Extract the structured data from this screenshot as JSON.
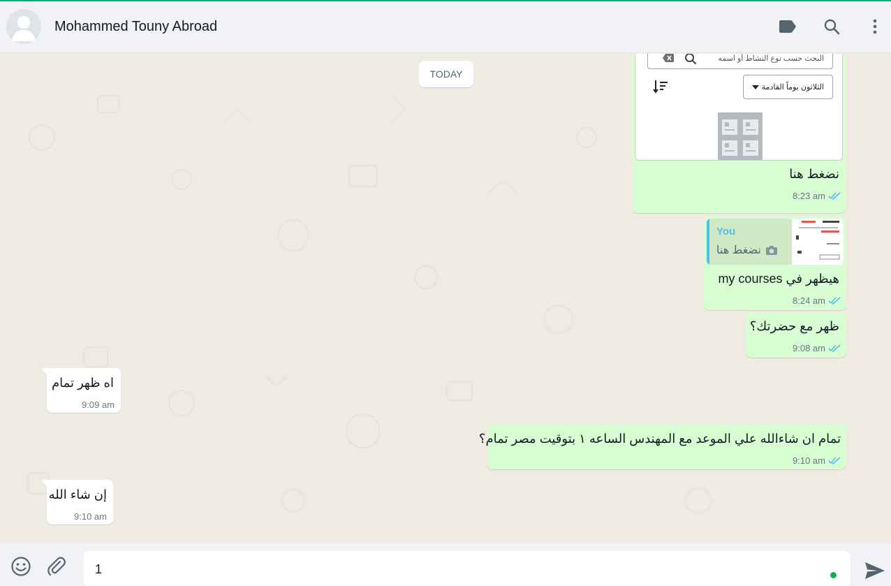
{
  "header": {
    "contact_name": "Mohammed Touny Abroad"
  },
  "chat": {
    "date_separator": "TODAY",
    "messages": [
      {
        "direction": "out",
        "kind": "image",
        "image": {
          "search_placeholder": "البحث حسب نوع النشاط أو اسمه",
          "select_value": "الثلاثون يوماً القادمة"
        },
        "text": "نضغط هنا",
        "time": "8:23 am",
        "status": "read"
      },
      {
        "direction": "out",
        "kind": "reply",
        "quote": {
          "author": "You",
          "text": "نضغط هنا"
        },
        "text": "هيظهر في my courses",
        "time": "8:24 am",
        "status": "read"
      },
      {
        "direction": "out",
        "text": "ظهر مع حضرتك؟",
        "time": "9:08 am",
        "status": "read"
      },
      {
        "direction": "in",
        "text": "اه ظهر تمام",
        "time": "9:09 am"
      },
      {
        "direction": "out",
        "text": "تمام ان شاءالله علي الموعد مع المهندس الساعه ١ بتوقيت مصر تمام؟",
        "time": "9:10 am",
        "status": "read"
      },
      {
        "direction": "in",
        "text": "إن شاء الله",
        "time": "9:10 am"
      }
    ]
  },
  "composer": {
    "value": "1"
  },
  "colors": {
    "accent": "#00a884",
    "outgoing_bubble": "#d9fdd3",
    "incoming_bubble": "#ffffff",
    "read_ticks": "#53bdeb",
    "chat_background": "#efeae2"
  },
  "icons": {
    "label": "label-icon",
    "search": "search-icon",
    "menu": "more-vertical-icon",
    "emoji": "emoji-icon",
    "attach": "paperclip-icon",
    "send": "send-icon",
    "camera": "camera-icon"
  }
}
